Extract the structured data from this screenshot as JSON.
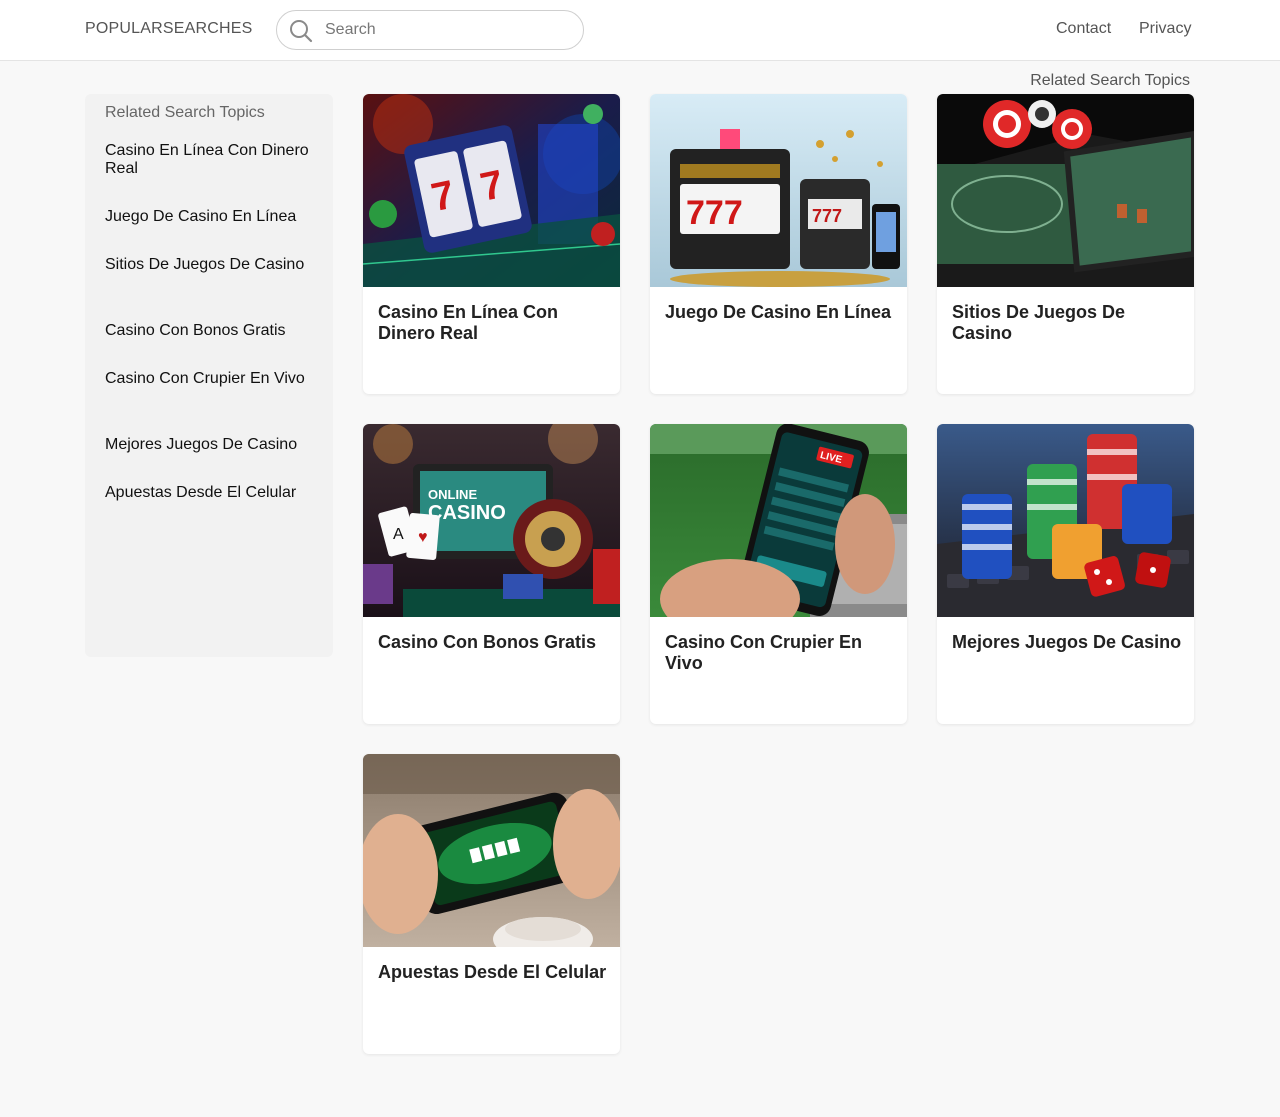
{
  "header": {
    "brand": "POPULARSEARCHES",
    "search_placeholder": "Search",
    "nav": {
      "contact": "Contact",
      "privacy": "Privacy"
    }
  },
  "related_label": "Related Search Topics",
  "sidebar": {
    "title": "Related Search Topics",
    "items": [
      "Casino En Línea Con Dinero Real",
      "Juego De Casino En Línea",
      "Sitios De Juegos De Casino",
      "Casino Con Bonos Gratis",
      "Casino Con Crupier En Vivo",
      "Mejores Juegos De Casino",
      "Apuestas Desde El Celular"
    ]
  },
  "cards": [
    {
      "title": "Casino En Línea Con Dinero Real",
      "image": "slot-machine-reels-neon-image"
    },
    {
      "title": "Juego De Casino En Línea",
      "image": "777-slot-machines-devices-image"
    },
    {
      "title": "Sitios De Juegos De Casino",
      "image": "casino-chips-tablet-table-image"
    },
    {
      "title": "Casino Con Bonos Gratis",
      "image": "online-casino-laptop-cards-roulette-image"
    },
    {
      "title": "Casino Con Crupier En Vivo",
      "image": "live-betting-phone-hands-image"
    },
    {
      "title": "Mejores Juegos De Casino",
      "image": "poker-chips-dice-keyboard-image"
    },
    {
      "title": "Apuestas Desde El Celular",
      "image": "poker-table-phone-hands-image"
    }
  ],
  "colors": {
    "page_bg": "#f8f8f8",
    "header_bg": "#ffffff",
    "sidebar_bg": "#f2f2f2",
    "card_bg": "#ffffff",
    "title_text": "#222222",
    "muted_text": "#555555"
  }
}
